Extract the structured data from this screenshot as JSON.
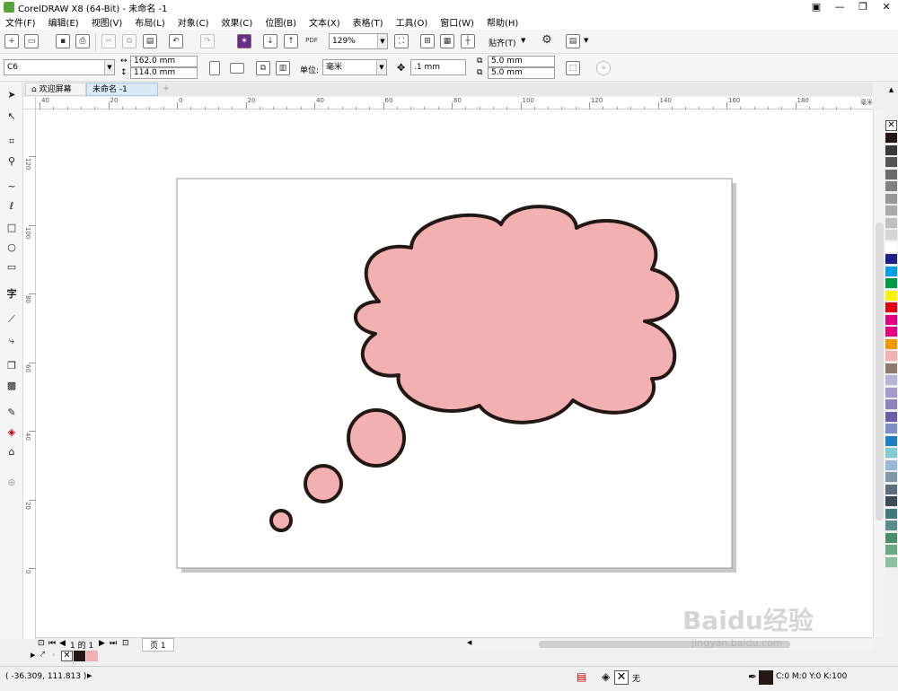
{
  "window": {
    "title": "CorelDRAW X8 (64-Bit) - 未命名 -1",
    "controls": [
      "—",
      "❐",
      "✕"
    ]
  },
  "menu": [
    "文件(F)",
    "编辑(E)",
    "视图(V)",
    "布局(L)",
    "对象(C)",
    "效果(C)",
    "位图(B)",
    "文本(X)",
    "表格(T)",
    "工具(O)",
    "窗口(W)",
    "帮助(H)"
  ],
  "standard_toolbar": {
    "zoom": "129%",
    "snap_label": "贴齐(T)"
  },
  "property_bar": {
    "paper_size": "C6",
    "width": "162.0 mm",
    "height": "114.0 mm",
    "units_label": "单位:",
    "units_value": "毫米",
    "nudge": ".1 mm",
    "dup_x": "5.0 mm",
    "dup_y": "5.0 mm"
  },
  "tabs": {
    "welcome": "欢迎屏幕",
    "document": "未命名 -1"
  },
  "rulers": {
    "top_labels": [
      "40",
      "20",
      "0",
      "20",
      "40",
      "60",
      "80",
      "100",
      "120",
      "140",
      "160",
      "180"
    ],
    "unit": "毫米",
    "left_labels": [
      "120",
      "100",
      "80",
      "60",
      "40",
      "20",
      "0"
    ]
  },
  "page_nav": {
    "page_indicator": "1 的 1",
    "page_tab": "页 1"
  },
  "status": {
    "coordinates": "( -36.309, 111.813 )",
    "fill_label": "无",
    "outline_color": "C:0 M:0 Y:0 K:100"
  },
  "drawing": {
    "cloud_fill": "#f2b1b0",
    "outline_color": "#231815"
  },
  "palette_colors": [
    "#231815",
    "#3a3a3a",
    "#555555",
    "#6b6b6b",
    "#808080",
    "#969696",
    "#aaaaaa",
    "#bfbfbf",
    "#d5d5d5",
    "#ffffff",
    "#1d2088",
    "#00a0e9",
    "#009944",
    "#fff100",
    "#e60012",
    "#e4007f",
    "#e4007f",
    "#f39800",
    "#f2b1b0",
    "#8c7a6b",
    "#b5b5d6",
    "#a59aca",
    "#8f82bc",
    "#6c5fa7",
    "#7d8fc3",
    "#1d7fc4",
    "#83ccd2",
    "#99b8d6",
    "#7f97a6",
    "#5c6d7a",
    "#3b4a54",
    "#3f7a79",
    "#5a8e8c",
    "#4a8e6a",
    "#6aa983",
    "#8cc0a0"
  ],
  "watermark": {
    "brand": "Baidu经验",
    "url": "jingyan.baidu.com"
  }
}
